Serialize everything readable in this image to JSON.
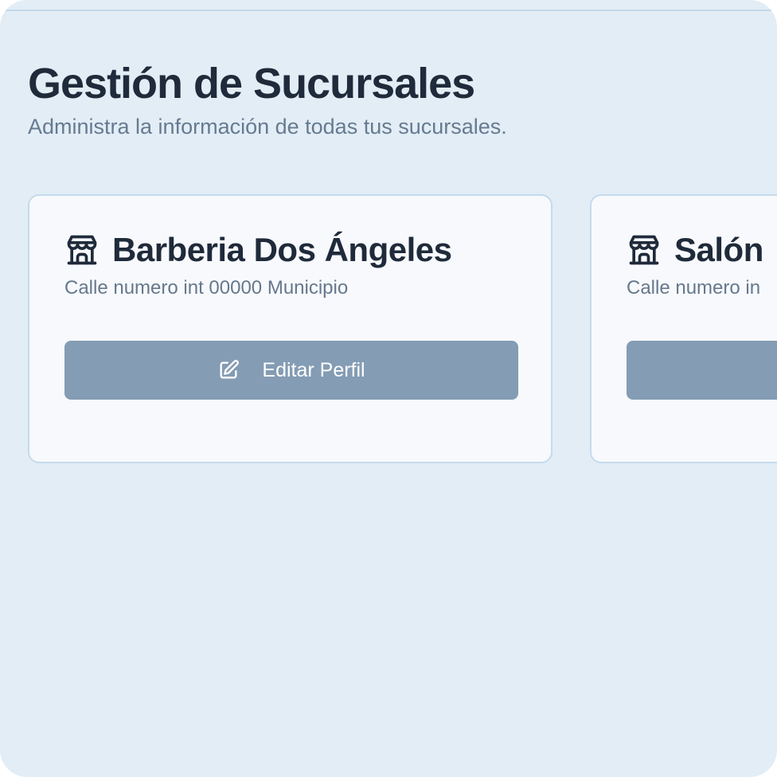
{
  "header": {
    "title": "Gestión de Sucursales",
    "subtitle": "Administra la información de todas tus sucursales."
  },
  "branches": [
    {
      "name": "Barberia Dos Ángeles",
      "address": "Calle numero int 00000 Municipio",
      "action_label": "Editar Perfil",
      "icon": "store-icon"
    },
    {
      "name": "Salón",
      "address": "Calle numero in",
      "action_label": "",
      "icon": "store-icon"
    }
  ],
  "colors": {
    "background": "#e2edf6",
    "card": "#f7f9fc",
    "button": "#849cb4",
    "title": "#1f2a3a",
    "muted": "#677a90"
  }
}
